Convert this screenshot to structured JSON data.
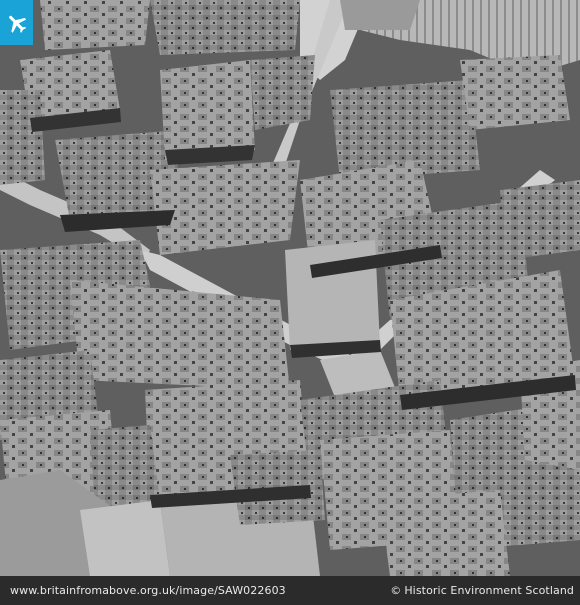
{
  "photo": {
    "subject": "aerial-photograph-town-centre",
    "colors": {
      "badge": "#1aa3d6",
      "footer_bg": "#2b2b2b",
      "footer_text": "#e9e9e9"
    }
  },
  "badge": {
    "icon": "airplane-icon"
  },
  "footer": {
    "url": "www.britainfromabove.org.uk/image/SAW022603",
    "copyright_symbol": "©",
    "copyright": "Historic Environment Scotland"
  }
}
